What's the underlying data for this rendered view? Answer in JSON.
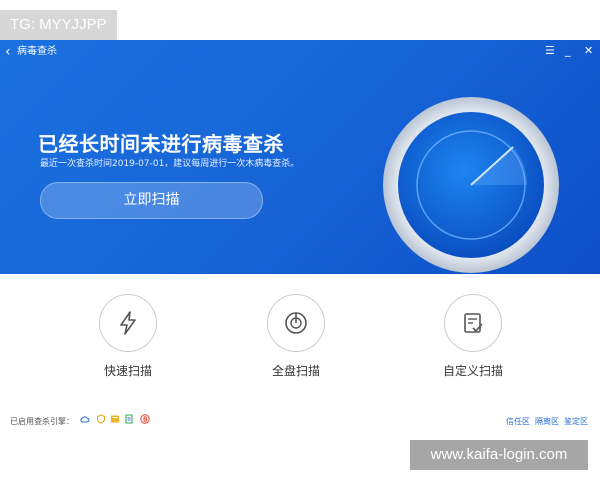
{
  "overlay_tag": "TG: MYYJJPP",
  "watermark": "www.kaifa-login.com",
  "window": {
    "back_icon": "chevron-left-icon",
    "title": "病毒查杀",
    "controls": {
      "menu": "☰",
      "minimize": "_",
      "close": "✕"
    }
  },
  "hero": {
    "headline": "已经长时间未进行病毒查杀",
    "subtitle": "最近一次查杀时间2019-07-01，建议每周进行一次木病毒查杀。",
    "scan_button": "立即扫描"
  },
  "options": [
    {
      "label": "快速扫描",
      "icon": "lightning-icon"
    },
    {
      "label": "全盘扫描",
      "icon": "disk-icon"
    },
    {
      "label": "自定义扫描",
      "icon": "checklist-icon"
    }
  ],
  "footer": {
    "engines_label": "已启用查杀引擎：",
    "engines": [
      "cloud-engine-icon",
      "shield-engine-icon",
      "folder-engine-icon",
      "document-engine-icon",
      "b-engine-icon"
    ],
    "links": [
      "信任区",
      "隔离区",
      "鉴定区"
    ]
  },
  "colors": {
    "accent": "#1766d8",
    "link": "#2c6fd6"
  }
}
